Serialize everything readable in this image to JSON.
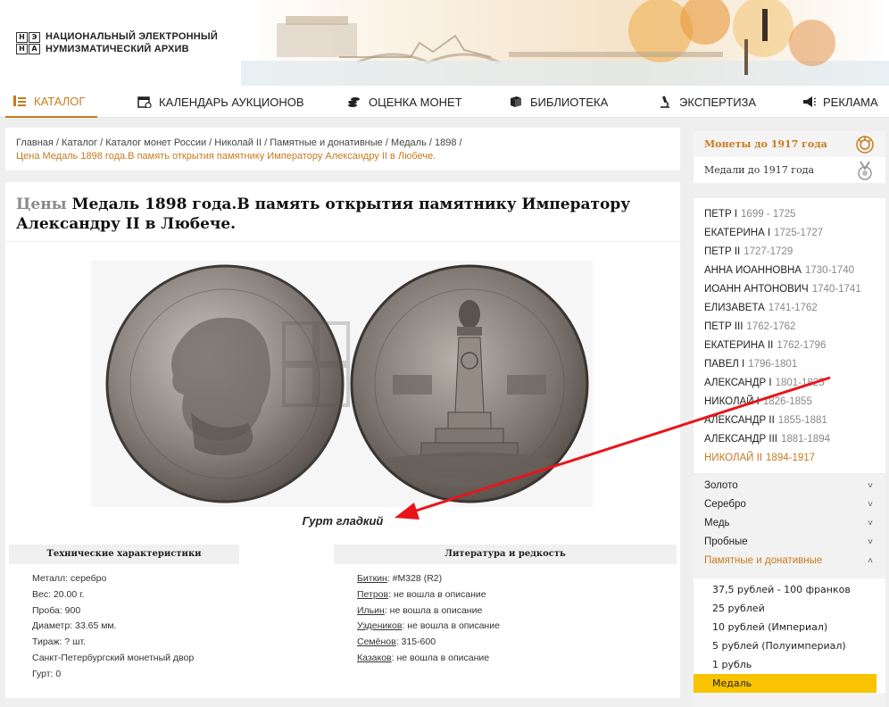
{
  "header": {
    "logo_letters": [
      "Н",
      "Э",
      "Н",
      "А"
    ],
    "logo_line1": "Национальный электронный",
    "logo_line2": "нумизматический архив"
  },
  "nav": [
    {
      "label": "КАТАЛОГ",
      "icon": "catalog-icon"
    },
    {
      "label": "КАЛЕНДАРЬ АУКЦИОНОВ",
      "icon": "calendar-icon"
    },
    {
      "label": "ОЦЕНКА МОНЕТ",
      "icon": "coins-icon"
    },
    {
      "label": "БИБЛИОТЕКА",
      "icon": "book-icon"
    },
    {
      "label": "ЭКСПЕРТИЗА",
      "icon": "microscope-icon"
    },
    {
      "label": "РЕКЛАМА",
      "icon": "megaphone-icon"
    }
  ],
  "breadcrumb": {
    "items": [
      "Главная",
      "Каталог",
      "Каталог монет России",
      "Николай II",
      "Памятные и донативные",
      "Медаль",
      "1898"
    ],
    "current": "Цена Медаль 1898 года.В память открытия памятнику Императору Александру II в Любече."
  },
  "main": {
    "title_prefix": "Цены",
    "title": "Медаль 1898 года.В память открытия памятнику Императору Александру II в Любече.",
    "edge": "Гурт гладкий",
    "tech_header": "Технические характеристики",
    "lit_header": "Литература и редкость",
    "tech": [
      "Металл: серебро",
      "Вес: 20.00 г.",
      "Проба: 900",
      "Диаметр: 33.65 мм.",
      "Тираж: ? шт.",
      "Санкт-Петербургский монетный двор",
      "Гурт: 0"
    ],
    "lit": [
      {
        "source": "Биткин",
        "value": "#M328 (R2)"
      },
      {
        "source": "Петров",
        "value": "не вошла в описание"
      },
      {
        "source": "Ильин",
        "value": "не вошла в описание"
      },
      {
        "source": "Уздеников",
        "value": "не вошла в описание"
      },
      {
        "source": "Семёнов",
        "value": "315-600"
      },
      {
        "source": "Казаков",
        "value": "не вошла в описание"
      }
    ]
  },
  "sidebar": {
    "categories": [
      "Монеты до 1917 года",
      "Медали до 1917 года"
    ],
    "rulers": [
      {
        "name": "ПЕТР I",
        "years": "1699 - 1725"
      },
      {
        "name": "ЕКАТЕРИНА I",
        "years": "1725-1727"
      },
      {
        "name": "ПЕТР II",
        "years": "1727-1729"
      },
      {
        "name": "АННА ИОАННОВНА",
        "years": "1730-1740"
      },
      {
        "name": "ИОАНН АНТОНОВИЧ",
        "years": "1740-1741"
      },
      {
        "name": "ЕЛИЗАВЕТА",
        "years": "1741-1762"
      },
      {
        "name": "ПЕТР III",
        "years": "1762-1762"
      },
      {
        "name": "ЕКАТЕРИНА II",
        "years": "1762-1796"
      },
      {
        "name": "ПАВЕЛ I",
        "years": "1796-1801"
      },
      {
        "name": "АЛЕКСАНДР I",
        "years": "1801-1825"
      },
      {
        "name": "НИКОЛАЙ I",
        "years": "1826-1855"
      },
      {
        "name": "АЛЕКСАНДР II",
        "years": "1855-1881"
      },
      {
        "name": "АЛЕКСАНДР III",
        "years": "1881-1894"
      },
      {
        "name": "НИКОЛАЙ II",
        "years": "1894-1917"
      }
    ],
    "metals": [
      "Золото",
      "Серебро",
      "Медь",
      "Пробные",
      "Памятные и донативные"
    ],
    "subcategories": [
      "37,5 рублей - 100 франков",
      "25 рублей",
      "10 рублей (Империал)",
      "5 рублей (Полуимпериал)",
      "1 рубль",
      "Медаль"
    ]
  },
  "colors": {
    "accent": "#c87a1e",
    "highlight": "#f9c300",
    "arrow": "#e8151b"
  }
}
